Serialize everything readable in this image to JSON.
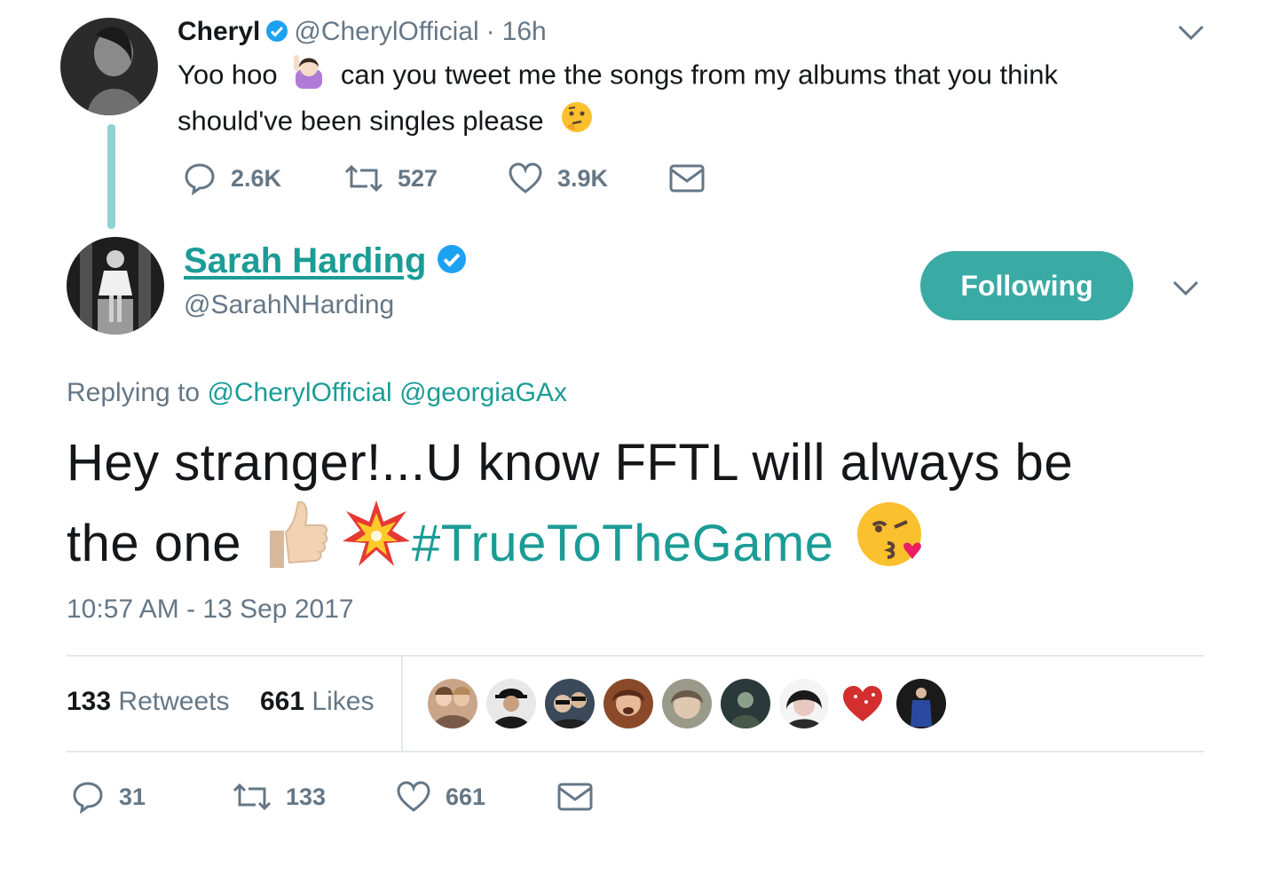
{
  "parent_tweet": {
    "display_name": "Cheryl",
    "handle": "@CherylOfficial",
    "separator": "·",
    "time_ago": "16h",
    "text_part1": "Yoo hoo",
    "text_part2": "can you tweet me the songs from my albums that you think",
    "text_part3": "should've been singles please",
    "emoji_1": "woman-raising-hand-icon",
    "emoji_2": "thinking-face-icon",
    "replies": "2.6K",
    "retweets": "527",
    "likes": "3.9K"
  },
  "main_tweet": {
    "display_name": "Sarah Harding",
    "handle": "@SarahNHarding",
    "follow_label": "Following",
    "replying_prefix": "Replying to",
    "replying_user_1": "@CherylOfficial",
    "replying_user_2": "@georgiaGAx",
    "text_line1": "Hey stranger!...U know FFTL will always be",
    "text_line2": "the one",
    "hashtag": "#TrueToTheGame",
    "timestamp": "10:57 AM - 13 Sep 2017",
    "retweet_count": "133",
    "retweet_label": "Retweets",
    "like_count": "661",
    "like_label": "Likes",
    "replies": "31",
    "retweets": "133",
    "likes": "661"
  },
  "colors": {
    "accent": "#1b9c96",
    "follow_button": "#3aaaa5",
    "thread_line": "#8fd3d1",
    "verified": "#1da1f2",
    "muted": "#657786"
  }
}
